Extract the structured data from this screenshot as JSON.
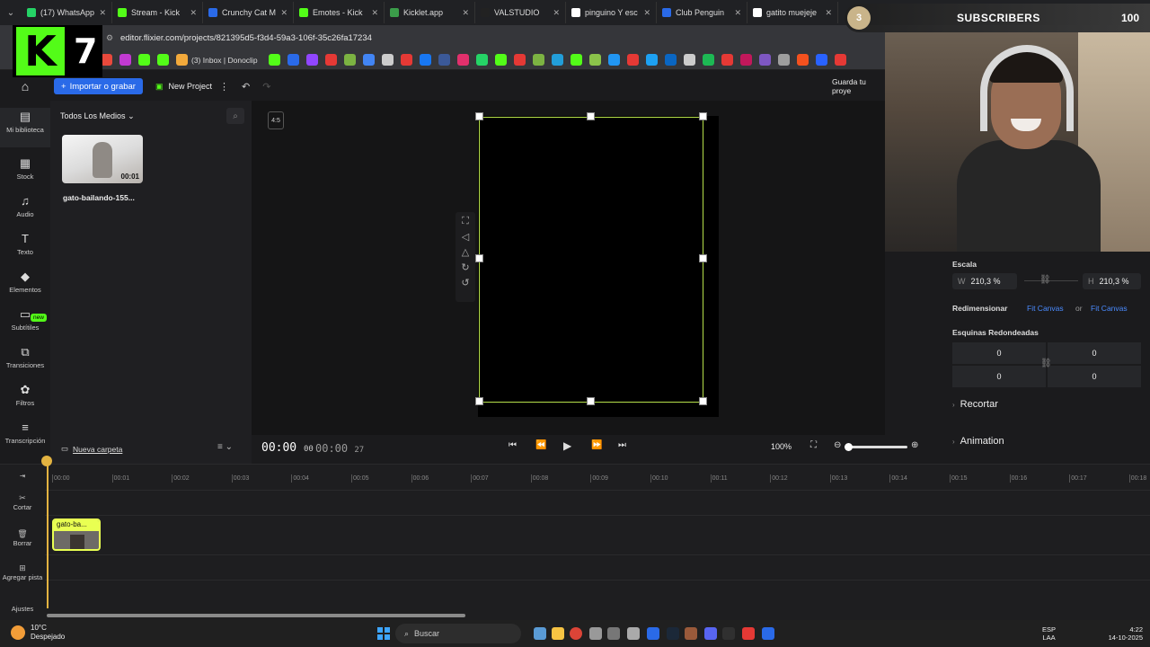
{
  "browser": {
    "tabs": [
      {
        "label": "(17) WhatsApp",
        "color": "#25d366"
      },
      {
        "label": "Stream - Kick",
        "color": "#53fc18"
      },
      {
        "label": "Crunchy Cat M",
        "color": "#2a6ae8"
      },
      {
        "label": "Emotes - Kick",
        "color": "#53fc18"
      },
      {
        "label": "Kicklet.app",
        "color": "#3b9d4a"
      },
      {
        "label": "VALSTUDIO",
        "color": "#222"
      },
      {
        "label": "pinguino Y esc",
        "color": "#ffffff"
      },
      {
        "label": "Club Penguin",
        "color": "#2a6ae8"
      },
      {
        "label": "gatito muejeje",
        "color": "#ffffff"
      }
    ],
    "url": "editor.flixier.com/projects/821395d5-f3d4-59a3-106f-35c26fa17234",
    "bookmark_label": "(3) Inbox | Donoclip"
  },
  "overlay": {
    "kick_number": "7",
    "kick_letter": "K",
    "subscribers_label": "SUBSCRIBERS",
    "subscribers_count": "100",
    "sub_circle": "3"
  },
  "toolbar": {
    "import_label": "Importar o grabar",
    "new_project_label": "New Project",
    "save_text": "Guarda tu proye"
  },
  "rail": [
    {
      "label": "Mi biblioteca",
      "icon": "file-icon"
    },
    {
      "label": "Stock",
      "icon": "grid-icon"
    },
    {
      "label": "Audio",
      "icon": "music-icon"
    },
    {
      "label": "Texto",
      "icon": "text-icon"
    },
    {
      "label": "Elementos",
      "icon": "shapes-icon"
    },
    {
      "label": "Subtítiles",
      "icon": "subtitles-icon"
    },
    {
      "label": "Transiciones",
      "icon": "transitions-icon"
    },
    {
      "label": "Filtros",
      "icon": "filters-icon"
    },
    {
      "label": "Transcripción",
      "icon": "transcription-icon"
    }
  ],
  "rail_new_badge": "new",
  "media": {
    "title": "Todos Los Medios",
    "item_name": "gato-bailando-155...",
    "item_duration": "00:01",
    "new_folder": "Nueva carpeta"
  },
  "stage": {
    "ratio": "4:5"
  },
  "playback": {
    "current": "00:00",
    "current_frames": "00",
    "total": "00:00",
    "total_frames": "27",
    "zoom": "100%"
  },
  "rightpanel": {
    "scale_label": "Escala",
    "w_prefix": "W",
    "w_value": "210,3 %",
    "h_prefix": "H",
    "h_value": "210,3 %",
    "resize_label": "Redimensionar",
    "fit_canvas_1": "Fit Canvas",
    "or": "or",
    "fit_canvas_2": "Fit Canvas",
    "corners_label": "Esquinas Redondeadas",
    "corners": [
      "0",
      "0",
      "0",
      "0"
    ],
    "crop_label": "Recortar",
    "animation_label": "Animation"
  },
  "timeline": {
    "ticks": [
      "00:00",
      "00:01",
      "00:02",
      "00:03",
      "00:04",
      "00:05",
      "00:06",
      "00:07",
      "00:08",
      "00:09",
      "00:10",
      "00:11",
      "00:12",
      "00:13",
      "00:14",
      "00:15",
      "00:16",
      "00:17",
      "00:18"
    ],
    "tools": [
      {
        "label": "Cortar"
      },
      {
        "label": "Borrar"
      },
      {
        "label": "Agregar pista"
      },
      {
        "label": "Ajustes"
      }
    ],
    "clip_label": "gato-ba..."
  },
  "taskbar": {
    "weather_temp": "10°C",
    "weather_desc": "Despejado",
    "search": "Buscar",
    "lang1": "ESP",
    "lang2": "LAA",
    "time": "4:22",
    "date": "14-10-2025"
  }
}
